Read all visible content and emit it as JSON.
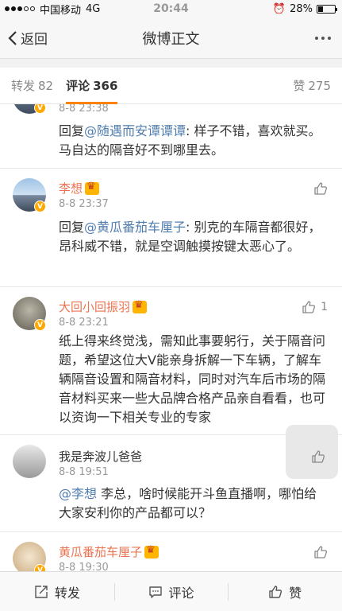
{
  "status_bar": {
    "carrier": "中国移动",
    "network": "4G",
    "time": "20:44",
    "battery": "28%",
    "battery_level": 0.28
  },
  "nav": {
    "back_label": "返回",
    "title": "微博正文"
  },
  "tabs": {
    "repost_label": "转发",
    "repost_count": "82",
    "comment_label": "评论",
    "comment_count": "366",
    "like_label": "赞",
    "like_count": "275"
  },
  "comments": [
    {
      "time": "8-8 23:38",
      "prefix": "回复",
      "mention": "@随遇而安谭谭谭",
      "body": ": 样子不错，喜欢就买。马自达的隔音好不到哪里去。"
    },
    {
      "name": "李想",
      "time": "8-8 23:37",
      "prefix": "回复",
      "mention": "@黄瓜番茄车厘子",
      "body": ": 别克的车隔音都很好，昂科威不错，就是空调触摸按键太恶心了。"
    },
    {
      "name": "大回小回振羽",
      "time": "8-8 23:21",
      "likes": "1",
      "body": "纸上得来终觉浅，需知此事要躬行，关于隔音问题，希望这位大V能亲身拆解一下车辆，了解车辆隔音设置和隔音材料，同时对汽车后市场的隔音材料买来一些大品牌合格产品亲自看看，也可以资询一下相关专业的专家"
    },
    {
      "name": "我是奔波儿爸爸",
      "time": "8-8 19:51",
      "mention": "@李想",
      "body": " 李总，啥时候能开斗鱼直播啊，哪怕给大家安利你的产品都可以？"
    },
    {
      "name": "黄瓜番茄车厘子",
      "time": "8-8 19:30"
    }
  ],
  "toolbar": {
    "repost_label": "转发",
    "comment_label": "评论",
    "like_label": "赞"
  },
  "colors": {
    "accent": "#ff8200",
    "username": "#eb7350",
    "mention": "#507daf",
    "vbadge": "#ffa800"
  },
  "icons": [
    "back-chevron-icon",
    "more-icon",
    "like-thumb-icon",
    "verified-badge-icon",
    "member-crown-icon",
    "repost-icon",
    "comment-icon"
  ]
}
